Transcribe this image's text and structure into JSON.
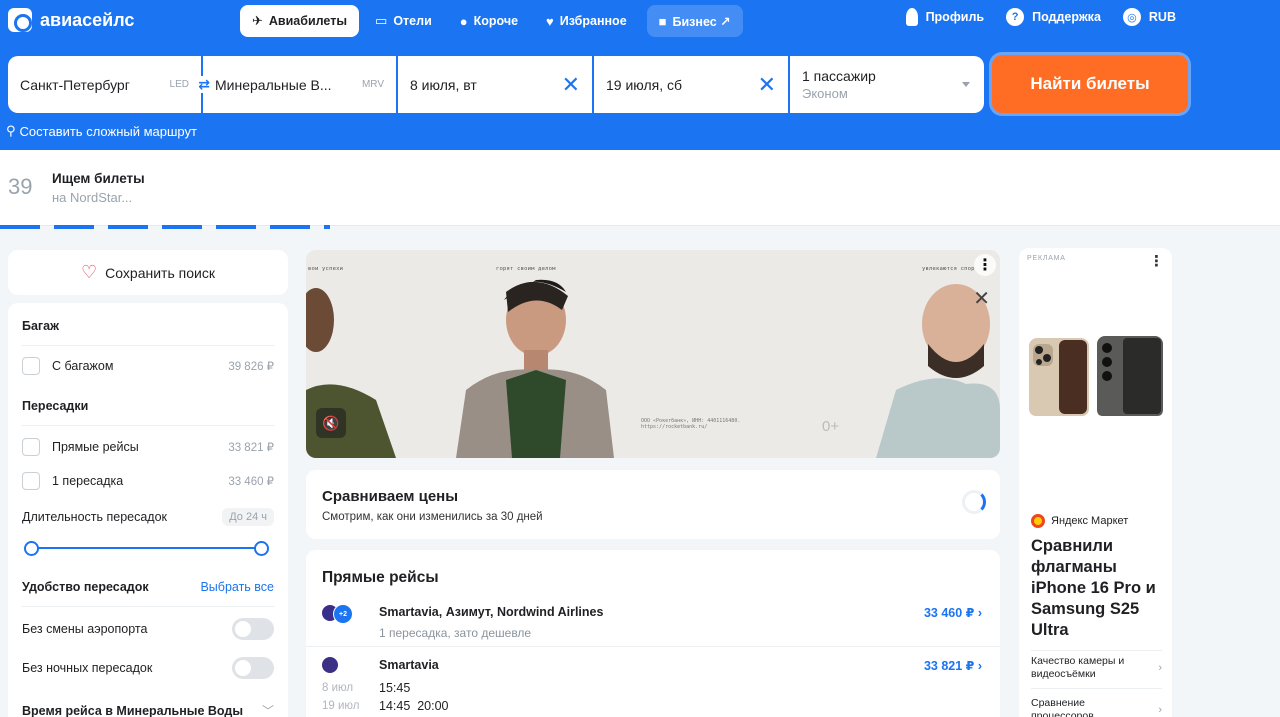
{
  "header": {
    "logo_text": "авиасейлс",
    "nav_tabs": [
      {
        "label": "Авиабилеты",
        "icon": "plane-icon",
        "active": true
      },
      {
        "label": "Отели",
        "icon": "bed-icon"
      },
      {
        "label": "Короче",
        "icon": "pin-icon"
      },
      {
        "label": "Избранное",
        "icon": "heart-icon"
      },
      {
        "label": "Бизнес ↗",
        "icon": "briefcase-icon"
      }
    ],
    "right": {
      "profile": "Профиль",
      "support": "Поддержка",
      "currency": "RUB"
    }
  },
  "search": {
    "origin": "Санкт-Петербург",
    "origin_iata": "LED",
    "destination": "Минеральные В...",
    "destination_iata": "MRV",
    "date_there": "8 июля, вт",
    "date_back": "19 июля, сб",
    "passengers": "1 пассажир",
    "cabin_class": "Эконом",
    "find_button": "Найти билеты",
    "complex_route": "Составить сложный маршрут"
  },
  "status": {
    "count": "39",
    "title": "Ищем билеты",
    "subtitle": "на NordStar..."
  },
  "sidebar": {
    "save_search": "Сохранить поиск",
    "baggage_heading": "Багаж",
    "with_baggage": "С багажом",
    "with_baggage_price": "39 826 ₽",
    "transfers_heading": "Пересадки",
    "direct": "Прямые рейсы",
    "direct_price": "33 821 ₽",
    "one_transfer": "1 пересадка",
    "one_transfer_price": "33 460 ₽",
    "duration_label": "Длительность пересадок",
    "duration_badge": "До 24 ч",
    "comfort_heading": "Удобство пересадок",
    "select_all": "Выбрать все",
    "no_airport_change": "Без смены аэропорта",
    "no_night": "Без ночных пересадок",
    "flight_time": "Время рейса в Минеральные Воды"
  },
  "banner": {
    "captions": [
      "вои успехи",
      "горят своим делом",
      "увлекаются спор"
    ],
    "legal": "ООО «Рокетбанк», ИНН: 4401116480. https://rocketbank.ru/",
    "age": "0+"
  },
  "compare": {
    "title": "Сравниваем цены",
    "subtitle": "Смотрим, как они изменились за 30 дней"
  },
  "direct_flights": {
    "title": "Прямые рейсы",
    "offers": [
      {
        "airline": "Smartavia, Азимут, Nordwind Airlines",
        "note": "1 пересадка, зато дешевле",
        "price": "33 460 ₽ ›"
      },
      {
        "airline": "Smartavia",
        "price": "33 821 ₽ ›",
        "date_there": "8 июл",
        "time_there": "15:45",
        "date_back": "19 июл",
        "time_back": "14:45  20:00"
      }
    ]
  },
  "ad": {
    "label": "РЕКЛАМА",
    "brand": "Яндекс Маркет",
    "title": "Сравнили флагманы iPhone 16 Pro и Samsung S25 Ultra",
    "links": [
      "Качество камеры и видеосъёмки",
      "Сравнение процессоров"
    ]
  }
}
